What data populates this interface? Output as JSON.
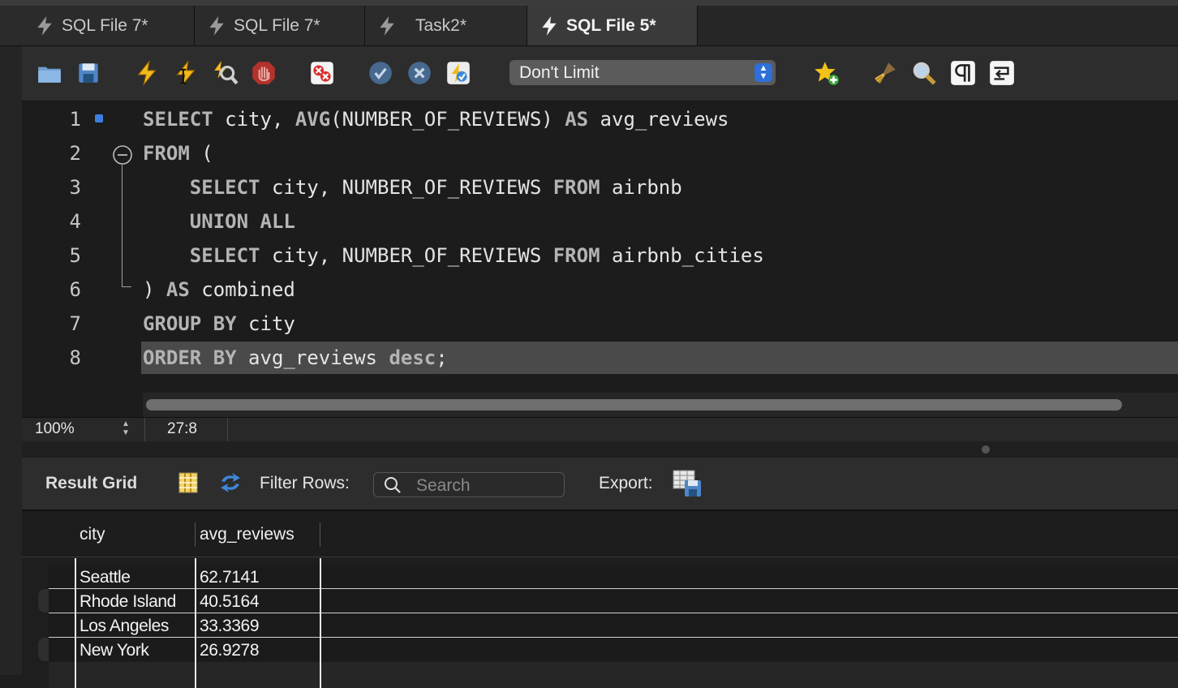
{
  "tabs": [
    {
      "label": "SQL File 7*",
      "active": false
    },
    {
      "label": "SQL File 7*",
      "active": false
    },
    {
      "label": "Task2*",
      "active": false
    },
    {
      "label": "SQL File 5*",
      "active": true
    }
  ],
  "toolbar": {
    "limit_select": {
      "value": "Don't Limit"
    },
    "icons": [
      "folder-icon",
      "save-icon",
      "execute-icon",
      "execute-current-icon",
      "explain-icon",
      "stop-icon",
      "toggle-error-icon",
      "commit-icon",
      "rollback-icon",
      "autocommit-icon",
      "bookmark-icon",
      "beautify-icon",
      "find-icon",
      "invisible-chars-icon",
      "wrap-lines-icon"
    ]
  },
  "editor": {
    "lines": [
      {
        "num": "1",
        "tokens": [
          {
            "t": "SELECT",
            "kw": true
          },
          {
            "t": " city, "
          },
          {
            "t": "AVG",
            "kw": true
          },
          {
            "t": "(NUMBER_OF_REVIEWS) "
          },
          {
            "t": "AS",
            "kw": true
          },
          {
            "t": " avg_reviews"
          }
        ]
      },
      {
        "num": "2",
        "tokens": [
          {
            "t": "FROM",
            "kw": true
          },
          {
            "t": " ("
          }
        ]
      },
      {
        "num": "3",
        "tokens": [
          {
            "t": "    "
          },
          {
            "t": "SELECT",
            "kw": true
          },
          {
            "t": " city, NUMBER_OF_REVIEWS "
          },
          {
            "t": "FROM",
            "kw": true
          },
          {
            "t": " airbnb"
          }
        ]
      },
      {
        "num": "4",
        "tokens": [
          {
            "t": "    "
          },
          {
            "t": "UNION ALL",
            "kw": true
          }
        ]
      },
      {
        "num": "5",
        "tokens": [
          {
            "t": "    "
          },
          {
            "t": "SELECT",
            "kw": true
          },
          {
            "t": " city, NUMBER_OF_REVIEWS "
          },
          {
            "t": "FROM",
            "kw": true
          },
          {
            "t": " airbnb_cities"
          }
        ]
      },
      {
        "num": "6",
        "tokens": [
          {
            "t": ") "
          },
          {
            "t": "AS",
            "kw": true
          },
          {
            "t": " combined"
          }
        ]
      },
      {
        "num": "7",
        "tokens": [
          {
            "t": "GROUP BY",
            "kw": true
          },
          {
            "t": " city"
          }
        ]
      },
      {
        "num": "8",
        "tokens": [
          {
            "t": "ORDER BY",
            "kw": true
          },
          {
            "t": " avg_reviews "
          },
          {
            "t": "desc",
            "kw": true
          },
          {
            "t": ";"
          }
        ]
      }
    ]
  },
  "status": {
    "zoom": "100%",
    "cursor": "27:8"
  },
  "result": {
    "title": "Result Grid",
    "filter_label": "Filter Rows:",
    "search_placeholder": "Search",
    "export_label": "Export:",
    "columns": [
      "city",
      "avg_reviews"
    ],
    "rows": [
      [
        "Seattle",
        "62.7141"
      ],
      [
        "Rhode Island",
        "40.5164"
      ],
      [
        "Los Angeles",
        "33.3369"
      ],
      [
        "New York",
        "26.9278"
      ]
    ]
  },
  "colors": {
    "accent": "#2f6fd8",
    "highlight_line": "#4a4a4a"
  }
}
